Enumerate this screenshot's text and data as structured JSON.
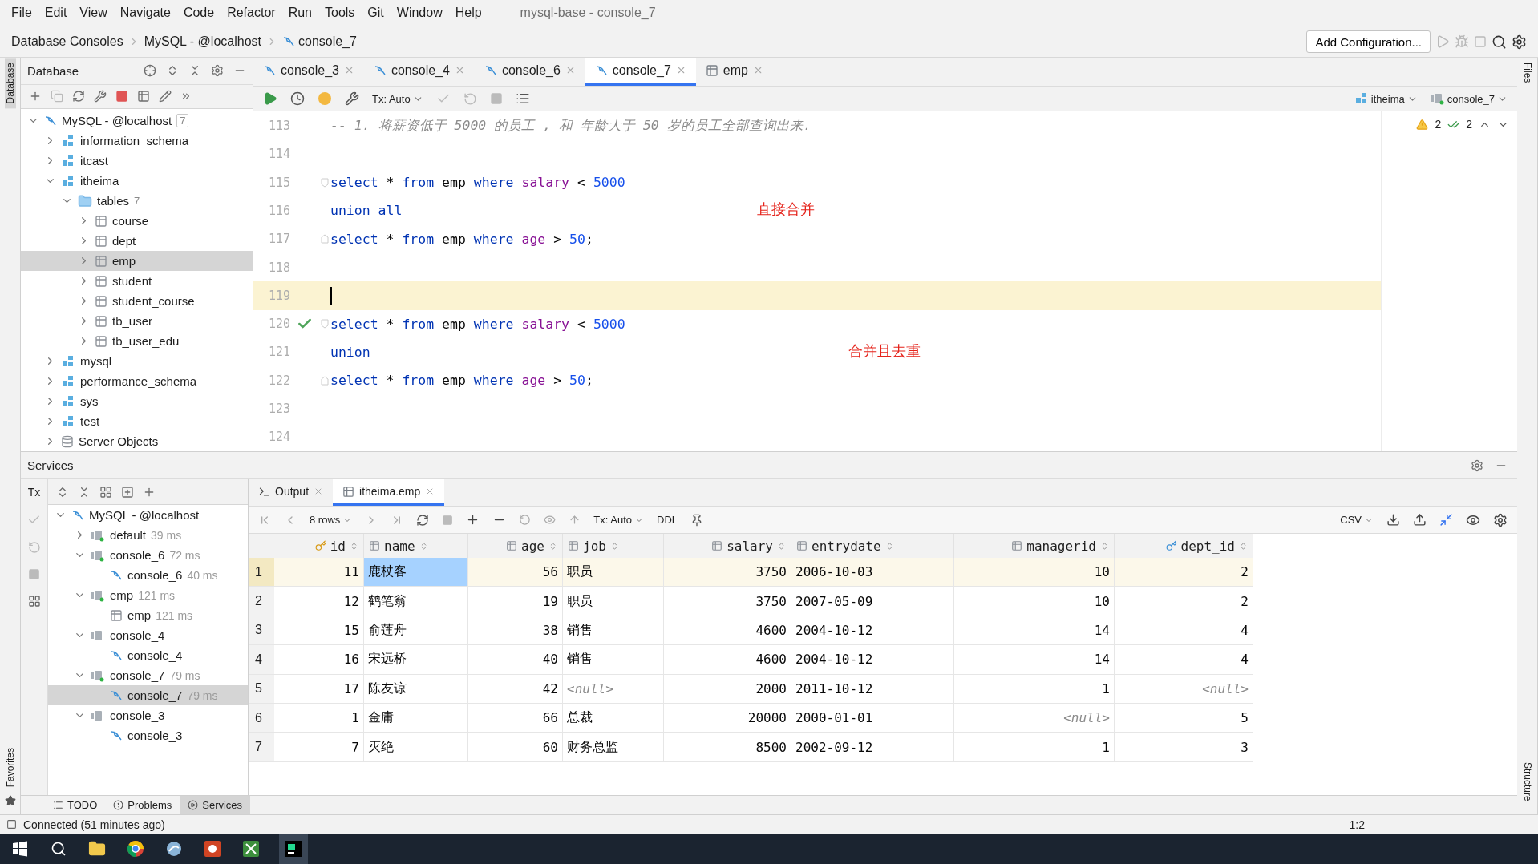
{
  "menu": [
    "File",
    "Edit",
    "View",
    "Navigate",
    "Code",
    "Refactor",
    "Run",
    "Tools",
    "Git",
    "Window",
    "Help"
  ],
  "window_title": "mysql-base - console_7",
  "breadcrumbs": [
    "Database Consoles",
    "MySQL - @localhost",
    "console_7"
  ],
  "run_config": "Add Configuration...",
  "left_strip": {
    "top": "Database",
    "bottom": "Favorites"
  },
  "right_strip": {
    "top": "Files",
    "bottom": "Structure"
  },
  "database_panel": {
    "title": "Database",
    "tree": [
      {
        "label": "MySQL - @localhost",
        "count": "7",
        "kind": "connection",
        "expanded": true,
        "selected": false,
        "children": [
          {
            "label": "information_schema",
            "kind": "schema",
            "expanded": false,
            "selected": false
          },
          {
            "label": "itcast",
            "kind": "schema",
            "expanded": false,
            "selected": false
          },
          {
            "label": "itheima",
            "kind": "schema",
            "expanded": true,
            "selected": false,
            "children": [
              {
                "label": "tables",
                "count": "7",
                "kind": "folder",
                "expanded": true,
                "selected": false,
                "children": [
                  {
                    "label": "course",
                    "kind": "table",
                    "expanded": false,
                    "selected": false
                  },
                  {
                    "label": "dept",
                    "kind": "table",
                    "expanded": false,
                    "selected": false
                  },
                  {
                    "label": "emp",
                    "kind": "table",
                    "expanded": false,
                    "selected": true
                  },
                  {
                    "label": "student",
                    "kind": "table",
                    "expanded": false,
                    "selected": false
                  },
                  {
                    "label": "student_course",
                    "kind": "table",
                    "expanded": false,
                    "selected": false
                  },
                  {
                    "label": "tb_user",
                    "kind": "table",
                    "expanded": false,
                    "selected": false
                  },
                  {
                    "label": "tb_user_edu",
                    "kind": "table",
                    "expanded": false,
                    "selected": false
                  }
                ]
              }
            ]
          },
          {
            "label": "mysql",
            "kind": "schema",
            "expanded": false,
            "selected": false
          },
          {
            "label": "performance_schema",
            "kind": "schema",
            "expanded": false,
            "selected": false
          },
          {
            "label": "sys",
            "kind": "schema",
            "expanded": false,
            "selected": false
          },
          {
            "label": "test",
            "kind": "schema",
            "expanded": false,
            "selected": false
          },
          {
            "label": "Server Objects",
            "kind": "server",
            "expanded": false,
            "selected": false
          }
        ]
      }
    ]
  },
  "editor": {
    "tabs": [
      {
        "label": "console_3",
        "kind": "console",
        "selected": false
      },
      {
        "label": "console_4",
        "kind": "console",
        "selected": false
      },
      {
        "label": "console_6",
        "kind": "console",
        "selected": false
      },
      {
        "label": "console_7",
        "kind": "console",
        "selected": true
      },
      {
        "label": "emp",
        "kind": "table",
        "selected": false
      }
    ],
    "tx": "Tx: Auto",
    "schema": "itheima",
    "session": "console_7",
    "warnings": "2",
    "passed": "2",
    "lines": [
      {
        "number": "113",
        "fold_start": false,
        "fold_end": false,
        "check": false,
        "current": false,
        "tokens": [
          {
            "kind": "comment",
            "text": "-- 1. 将薪资低于 5000 的员工 , 和 年龄大于 50 岁的员工全部查询出来."
          }
        ]
      },
      {
        "number": "114",
        "fold_start": false,
        "fold_end": false,
        "check": false,
        "current": false
      },
      {
        "number": "115",
        "fold_start": true,
        "fold_end": false,
        "check": false,
        "current": false,
        "tokens": [
          {
            "kind": "keyword",
            "text": "select"
          },
          {
            "kind": "plain",
            "text": " * "
          },
          {
            "kind": "keyword",
            "text": "from"
          },
          {
            "kind": "plain",
            "text": " emp "
          },
          {
            "kind": "keyword",
            "text": "where"
          },
          {
            "kind": "column",
            "text": " salary"
          },
          {
            "kind": "plain",
            "text": " < "
          },
          {
            "kind": "number",
            "text": "5000"
          }
        ]
      },
      {
        "number": "116",
        "fold_start": false,
        "fold_end": false,
        "check": false,
        "current": false,
        "note": "直接合并",
        "tokens": [
          {
            "kind": "keyword",
            "text": "union all"
          }
        ]
      },
      {
        "number": "117",
        "fold_start": false,
        "fold_end": true,
        "check": false,
        "current": false,
        "tokens": [
          {
            "kind": "keyword",
            "text": "select"
          },
          {
            "kind": "plain",
            "text": " * "
          },
          {
            "kind": "keyword",
            "text": "from"
          },
          {
            "kind": "plain",
            "text": " emp "
          },
          {
            "kind": "keyword",
            "text": "where"
          },
          {
            "kind": "column",
            "text": " age"
          },
          {
            "kind": "plain",
            "text": " > "
          },
          {
            "kind": "number",
            "text": "50"
          },
          {
            "kind": "plain",
            "text": ";"
          }
        ]
      },
      {
        "number": "118",
        "fold_start": false,
        "fold_end": false,
        "check": false,
        "current": false
      },
      {
        "number": "119",
        "fold_start": false,
        "fold_end": false,
        "check": false,
        "current": true
      },
      {
        "number": "120",
        "fold_start": true,
        "fold_end": false,
        "check": true,
        "current": false,
        "tokens": [
          {
            "kind": "keyword",
            "text": "select"
          },
          {
            "kind": "plain",
            "text": " * "
          },
          {
            "kind": "keyword",
            "text": "from"
          },
          {
            "kind": "plain",
            "text": " emp "
          },
          {
            "kind": "keyword",
            "text": "where"
          },
          {
            "kind": "column",
            "text": " salary"
          },
          {
            "kind": "plain",
            "text": " < "
          },
          {
            "kind": "number",
            "text": "5000"
          }
        ]
      },
      {
        "number": "121",
        "fold_start": false,
        "fold_end": false,
        "check": false,
        "current": false,
        "note": "合并且去重",
        "tokens": [
          {
            "kind": "keyword",
            "text": "union"
          }
        ]
      },
      {
        "number": "122",
        "fold_start": false,
        "fold_end": true,
        "check": false,
        "current": false,
        "tokens": [
          {
            "kind": "keyword",
            "text": "select"
          },
          {
            "kind": "plain",
            "text": " * "
          },
          {
            "kind": "keyword",
            "text": "from"
          },
          {
            "kind": "plain",
            "text": " emp "
          },
          {
            "kind": "keyword",
            "text": "where"
          },
          {
            "kind": "column",
            "text": " age"
          },
          {
            "kind": "plain",
            "text": " > "
          },
          {
            "kind": "number",
            "text": "50"
          },
          {
            "kind": "plain",
            "text": ";"
          }
        ]
      },
      {
        "number": "123",
        "fold_start": false,
        "fold_end": false,
        "check": false,
        "current": false
      },
      {
        "number": "124",
        "fold_start": false,
        "fold_end": false,
        "check": false,
        "current": false
      }
    ]
  },
  "services": {
    "title": "Services",
    "tx": "Tx",
    "tree": [
      {
        "label": "MySQL - @localhost",
        "kind": "connection",
        "expanded": true,
        "selected": false,
        "children": [
          {
            "label": "default",
            "time": "39 ms",
            "kind": "session",
            "expanded": false,
            "selected": false
          },
          {
            "label": "console_6",
            "time": "72 ms",
            "kind": "session",
            "expanded": true,
            "selected": false,
            "children": [
              {
                "label": "console_6",
                "time": "40 ms",
                "kind": "console",
                "selected": false
              }
            ]
          },
          {
            "label": "emp",
            "time": "121 ms",
            "kind": "session",
            "expanded": true,
            "selected": false,
            "children": [
              {
                "label": "emp",
                "time": "121 ms",
                "kind": "table",
                "selected": false
              }
            ]
          },
          {
            "label": "console_4",
            "kind": "idle",
            "expanded": true,
            "selected": false,
            "children": [
              {
                "label": "console_4",
                "kind": "console",
                "selected": false
              }
            ]
          },
          {
            "label": "console_7",
            "time": "79 ms",
            "kind": "session",
            "expanded": true,
            "selected": false,
            "children": [
              {
                "label": "console_7",
                "time": "79 ms",
                "kind": "console",
                "selected": true
              }
            ]
          },
          {
            "label": "console_3",
            "kind": "idle",
            "expanded": true,
            "selected": false,
            "children": [
              {
                "label": "console_3",
                "kind": "console",
                "selected": false
              }
            ]
          }
        ]
      }
    ],
    "tabs": [
      {
        "label": "Output",
        "kind": "output",
        "selected": false
      },
      {
        "label": "itheima.emp",
        "kind": "table",
        "selected": true
      }
    ],
    "grid": {
      "rows_label": "8 rows",
      "tx": "Tx: Auto",
      "ddl": "DDL",
      "export": "CSV",
      "columns": [
        {
          "name": "id",
          "kind": "primary_key"
        },
        {
          "name": "name",
          "kind": "text"
        },
        {
          "name": "age",
          "kind": "number"
        },
        {
          "name": "job",
          "kind": "text"
        },
        {
          "name": "salary",
          "kind": "number"
        },
        {
          "name": "entrydate",
          "kind": "text"
        },
        {
          "name": "managerid",
          "kind": "number"
        },
        {
          "name": "dept_id",
          "kind": "foreign_key"
        }
      ],
      "rows": [
        {
          "number": "1",
          "current": true,
          "cells": [
            {
              "text": "11",
              "kind": "value",
              "selected": false
            },
            {
              "text": "鹿杖客",
              "kind": "value",
              "selected": true
            },
            {
              "text": "56",
              "kind": "value",
              "selected": false
            },
            {
              "text": "职员",
              "kind": "value",
              "selected": false
            },
            {
              "text": "3750",
              "kind": "value",
              "selected": false
            },
            {
              "text": "2006-10-03",
              "kind": "value",
              "selected": false
            },
            {
              "text": "10",
              "kind": "value",
              "selected": false
            },
            {
              "text": "2",
              "kind": "value",
              "selected": false
            }
          ]
        },
        {
          "number": "2",
          "current": false,
          "cells": [
            {
              "text": "12",
              "kind": "value",
              "selected": false
            },
            {
              "text": "鹤笔翁",
              "kind": "value",
              "selected": false
            },
            {
              "text": "19",
              "kind": "value",
              "selected": false
            },
            {
              "text": "职员",
              "kind": "value",
              "selected": false
            },
            {
              "text": "3750",
              "kind": "value",
              "selected": false
            },
            {
              "text": "2007-05-09",
              "kind": "value",
              "selected": false
            },
            {
              "text": "10",
              "kind": "value",
              "selected": false
            },
            {
              "text": "2",
              "kind": "value",
              "selected": false
            }
          ]
        },
        {
          "number": "3",
          "current": false,
          "cells": [
            {
              "text": "15",
              "kind": "value",
              "selected": false
            },
            {
              "text": "俞莲舟",
              "kind": "value",
              "selected": false
            },
            {
              "text": "38",
              "kind": "value",
              "selected": false
            },
            {
              "text": "销售",
              "kind": "value",
              "selected": false
            },
            {
              "text": "4600",
              "kind": "value",
              "selected": false
            },
            {
              "text": "2004-10-12",
              "kind": "value",
              "selected": false
            },
            {
              "text": "14",
              "kind": "value",
              "selected": false
            },
            {
              "text": "4",
              "kind": "value",
              "selected": false
            }
          ]
        },
        {
          "number": "4",
          "current": false,
          "cells": [
            {
              "text": "16",
              "kind": "value",
              "selected": false
            },
            {
              "text": "宋远桥",
              "kind": "value",
              "selected": false
            },
            {
              "text": "40",
              "kind": "value",
              "selected": false
            },
            {
              "text": "销售",
              "kind": "value",
              "selected": false
            },
            {
              "text": "4600",
              "kind": "value",
              "selected": false
            },
            {
              "text": "2004-10-12",
              "kind": "value",
              "selected": false
            },
            {
              "text": "14",
              "kind": "value",
              "selected": false
            },
            {
              "text": "4",
              "kind": "value",
              "selected": false
            }
          ]
        },
        {
          "number": "5",
          "current": false,
          "cells": [
            {
              "text": "17",
              "kind": "value",
              "selected": false
            },
            {
              "text": "陈友谅",
              "kind": "value",
              "selected": false
            },
            {
              "text": "42",
              "kind": "value",
              "selected": false
            },
            {
              "text": "<null>",
              "kind": "null",
              "selected": false
            },
            {
              "text": "2000",
              "kind": "value",
              "selected": false
            },
            {
              "text": "2011-10-12",
              "kind": "value",
              "selected": false
            },
            {
              "text": "1",
              "kind": "value",
              "selected": false
            },
            {
              "text": "<null>",
              "kind": "null",
              "selected": false
            }
          ]
        },
        {
          "number": "6",
          "current": false,
          "cells": [
            {
              "text": "1",
              "kind": "value",
              "selected": false
            },
            {
              "text": "金庸",
              "kind": "value",
              "selected": false
            },
            {
              "text": "66",
              "kind": "value",
              "selected": false
            },
            {
              "text": "总裁",
              "kind": "value",
              "selected": false
            },
            {
              "text": "20000",
              "kind": "value",
              "selected": false
            },
            {
              "text": "2000-01-01",
              "kind": "value",
              "selected": false
            },
            {
              "text": "<null>",
              "kind": "null",
              "selected": false
            },
            {
              "text": "5",
              "kind": "value",
              "selected": false
            }
          ]
        },
        {
          "number": "7",
          "current": false,
          "cells": [
            {
              "text": "7",
              "kind": "value",
              "selected": false
            },
            {
              "text": "灭绝",
              "kind": "value",
              "selected": false
            },
            {
              "text": "60",
              "kind": "value",
              "selected": false
            },
            {
              "text": "财务总监",
              "kind": "value",
              "selected": false
            },
            {
              "text": "8500",
              "kind": "value",
              "selected": false
            },
            {
              "text": "2002-09-12",
              "kind": "value",
              "selected": false
            },
            {
              "text": "1",
              "kind": "value",
              "selected": false
            },
            {
              "text": "3",
              "kind": "value",
              "selected": false
            }
          ]
        }
      ]
    }
  },
  "bottom_tabs": [
    {
      "label": "TODO",
      "kind": "list",
      "selected": false
    },
    {
      "label": "Problems",
      "kind": "problems",
      "selected": false
    },
    {
      "label": "Services",
      "kind": "services",
      "selected": true
    }
  ],
  "status": {
    "text": "Connected (51 minutes ago)",
    "position": "1:2"
  }
}
